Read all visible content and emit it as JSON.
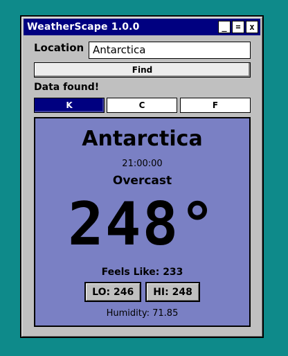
{
  "window": {
    "title": "WeatherScape 1.0.0",
    "controls": {
      "minimize": "_",
      "maximize": "=",
      "close": "x"
    }
  },
  "search": {
    "label": "Location",
    "value": "Antarctica",
    "button": "Find"
  },
  "status": "Data found!",
  "units": {
    "k": "K",
    "c": "C",
    "f": "F",
    "selected": "K"
  },
  "weather": {
    "city": "Antarctica",
    "time": "21:00:00",
    "condition": "Overcast",
    "temperature": "248°",
    "feels_like": "Feels Like: 233",
    "low": "LO: 246",
    "high": "HI: 248",
    "humidity": "Humidity: 71.85"
  },
  "colors": {
    "desktop": "#0e8a8a",
    "titlebar": "#000080",
    "panel": "#7a80c4",
    "window": "#c0c0c0"
  }
}
